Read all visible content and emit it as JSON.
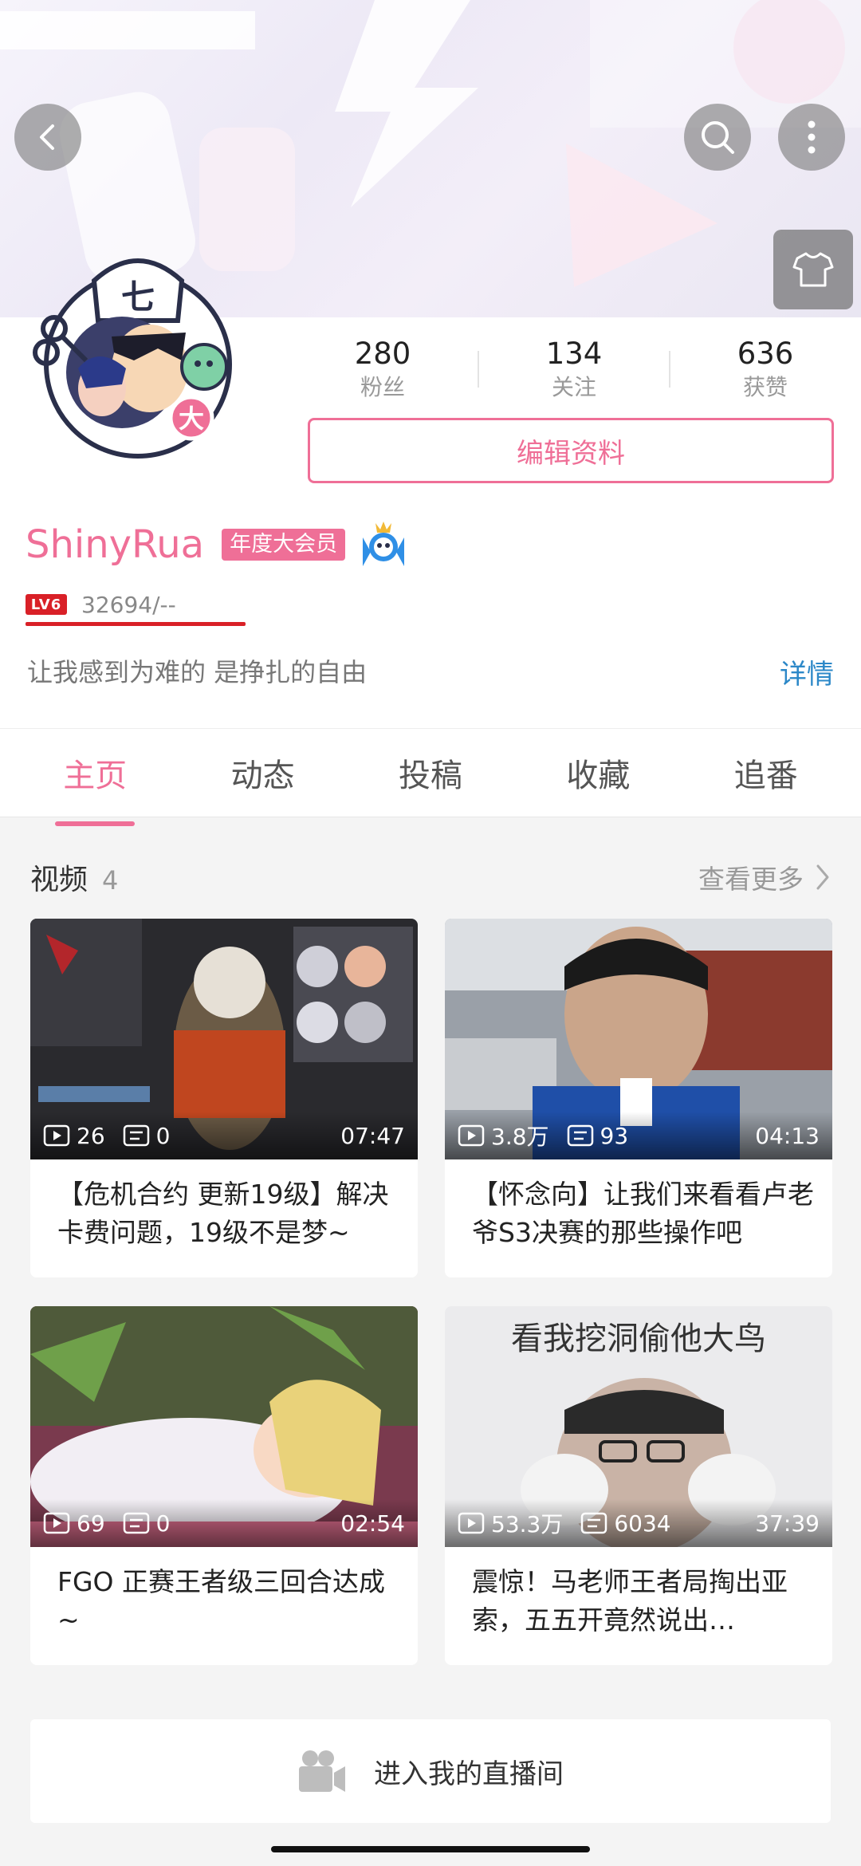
{
  "banner": {
    "back_icon": "chevron-left-icon",
    "search_icon": "search-icon",
    "more_icon": "more-vertical-icon",
    "shirt_icon": "tshirt-icon"
  },
  "profile": {
    "stats": [
      {
        "value": "280",
        "label": "粉丝"
      },
      {
        "value": "134",
        "label": "关注"
      },
      {
        "value": "636",
        "label": "获赞"
      }
    ],
    "edit_label": "编辑资料",
    "username": "ShinyRua",
    "vip_label": "年度大会员",
    "level_badge": "LV6",
    "exp": "32694/--",
    "signature": "让我感到为难的 是挣扎的自由",
    "detail_link": "详情"
  },
  "tabs": [
    "主页",
    "动态",
    "投稿",
    "收藏",
    "追番"
  ],
  "active_tab": 0,
  "videos_section": {
    "title": "视频",
    "count": "4",
    "see_more": "查看更多"
  },
  "videos": [
    {
      "plays": "26",
      "comments": "0",
      "duration": "07:47",
      "title": "【危机合约 更新19级】解决卡费问题，19级不是梦~"
    },
    {
      "plays": "3.8万",
      "comments": "93",
      "duration": "04:13",
      "title": "【怀念向】让我们来看看卢老爷S3决赛的那些操作吧"
    },
    {
      "plays": "69",
      "comments": "0",
      "duration": "02:54",
      "title": "FGO 正赛王者级三回合达成~"
    },
    {
      "plays": "53.3万",
      "comments": "6034",
      "duration": "37:39",
      "title": "震惊！马老师王者局掏出亚索，五五开竟然说出…"
    }
  ],
  "thumb_caption_4": "看我挖洞偷他大鸟",
  "live": {
    "label": "进入我的直播间",
    "icon": "camera-icon"
  },
  "colors": {
    "accent": "#ef6f97",
    "link": "#2c88c8",
    "level": "#d92027"
  }
}
